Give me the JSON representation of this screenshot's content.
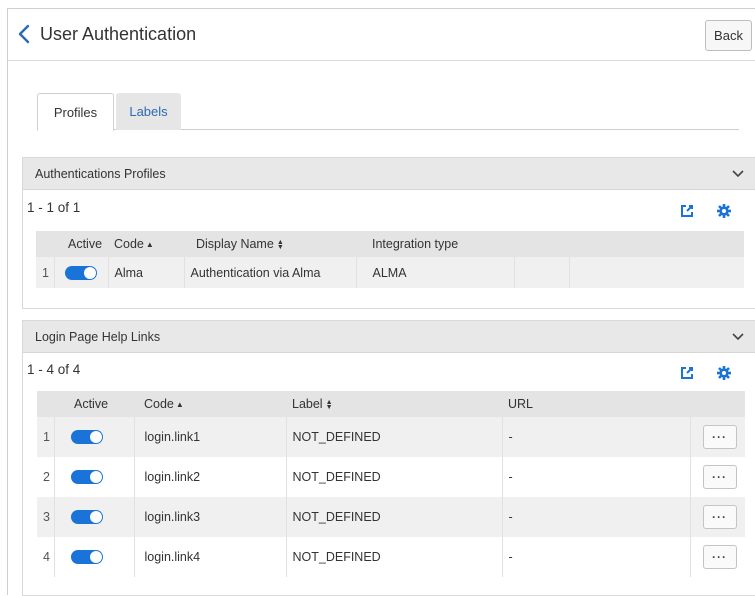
{
  "header": {
    "title": "User Authentication",
    "back_label": "Back",
    "back_icon": "chevron-left-icon"
  },
  "tabs": [
    {
      "label": "Profiles",
      "active": true
    },
    {
      "label": "Labels",
      "active": false
    }
  ],
  "profiles_panel": {
    "title": "Authentications Profiles",
    "count": "1 - 1 of 1",
    "columns": [
      "Active",
      "Code",
      "Display Name",
      "Integration type"
    ],
    "rows": [
      {
        "num": "1",
        "active": true,
        "code": "Alma",
        "display_name": "Authentication via Alma",
        "integration_type": "ALMA"
      }
    ]
  },
  "links_panel": {
    "title": "Login Page Help Links",
    "count": "1 - 4 of 4",
    "columns": [
      "Active",
      "Code",
      "Label",
      "URL"
    ],
    "rows": [
      {
        "num": "1",
        "active": true,
        "code": "login.link1",
        "label": "NOT_DEFINED",
        "url": "-"
      },
      {
        "num": "2",
        "active": true,
        "code": "login.link2",
        "label": "NOT_DEFINED",
        "url": "-"
      },
      {
        "num": "3",
        "active": true,
        "code": "login.link3",
        "label": "NOT_DEFINED",
        "url": "-"
      },
      {
        "num": "4",
        "active": true,
        "code": "login.link4",
        "label": "NOT_DEFINED",
        "url": "-"
      }
    ],
    "row_action_label": "···"
  },
  "colors": {
    "accent": "#1a73d9",
    "link": "#2b6ab5",
    "panel_header": "#e8e8e8"
  }
}
